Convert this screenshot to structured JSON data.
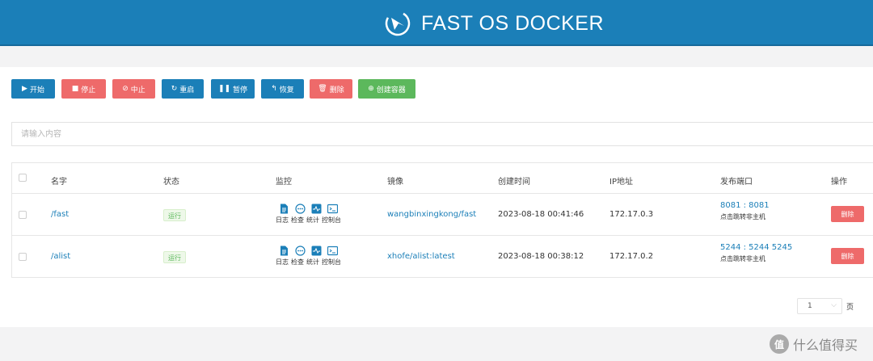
{
  "header": {
    "title": "FAST OS DOCKER"
  },
  "toolbar": {
    "start": {
      "icon": "▶",
      "label": "开始"
    },
    "stop": {
      "icon": "■",
      "label": "停止"
    },
    "abort": {
      "icon": "⊘",
      "label": "中止"
    },
    "restart": {
      "icon": "↻",
      "label": "重启"
    },
    "pause": {
      "icon": "❚❚",
      "label": "暂停"
    },
    "resume": {
      "icon": "↰",
      "label": "恢复"
    },
    "delete": {
      "icon": "🗑",
      "label": "删除"
    },
    "create": {
      "icon": "⊕",
      "label": "创建容器"
    }
  },
  "search": {
    "placeholder": "请输入内容",
    "value": ""
  },
  "table": {
    "columns": [
      "名字",
      "状态",
      "监控",
      "镜像",
      "创建时间",
      "IP地址",
      "发布端口",
      "操作"
    ],
    "monitor_labels": [
      "日志",
      "检查",
      "统计",
      "控制台"
    ],
    "rows": [
      {
        "name": "/fast",
        "status": "运行",
        "image": "wangbinxingkong/fast",
        "created": "2023-08-18 00:41:46",
        "ip": "172.17.0.3",
        "ports": "8081 : 8081",
        "port_hint": "点击跳转非主机",
        "action": "删除"
      },
      {
        "name": "/alist",
        "status": "运行",
        "image": "xhofe/alist:latest",
        "created": "2023-08-18 00:38:12",
        "ip": "172.17.0.2",
        "ports": "5244 : 5244 5245",
        "port_hint": "点击跳转非主机",
        "action": "删除"
      }
    ]
  },
  "pagination": {
    "selected": "1",
    "unit": "页"
  },
  "watermark": {
    "logo": "值",
    "text": "什么值得买"
  },
  "colors": {
    "primary": "#1b7fb8",
    "danger": "#ee6a6a",
    "success": "#5cb85c"
  }
}
